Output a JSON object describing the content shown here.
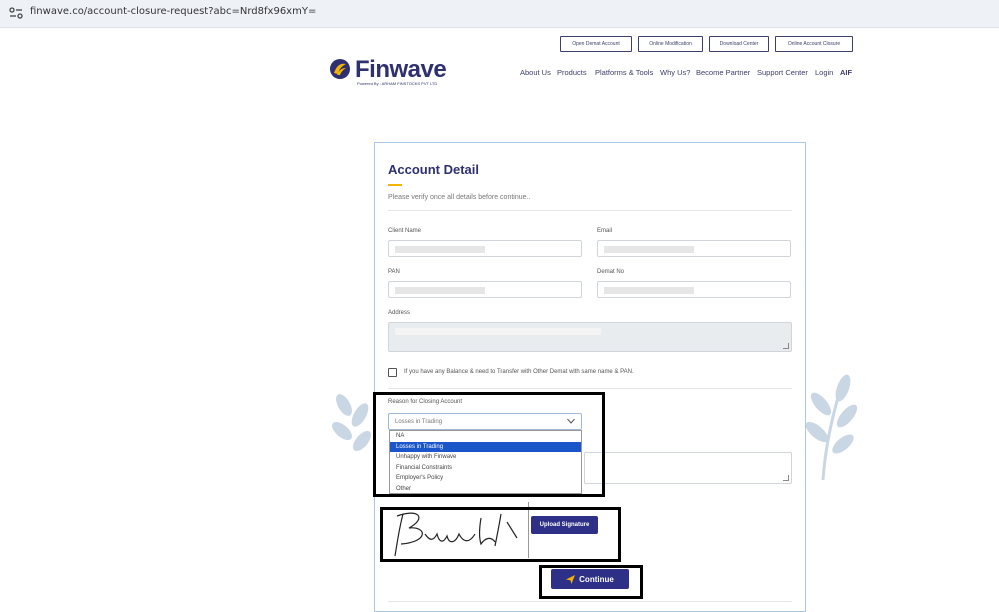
{
  "browser": {
    "url": "finwave.co/account-closure-request?abc=Nrd8fx96xmY="
  },
  "header": {
    "top_buttons": [
      "Open Demat Account",
      "Online Modification",
      "Download Center",
      "Online Account Closure"
    ],
    "logo_text": "Finwave",
    "logo_subtext": "Powered By : ARHAM FINSTOCKS PVT LTD",
    "nav": [
      "About Us",
      "Products",
      "Platforms & Tools",
      "Why Us?",
      "Become Partner",
      "Support Center",
      "Login",
      "AIF"
    ]
  },
  "form": {
    "title": "Account Detail",
    "subtitle": "Please verify once all details before continue..",
    "labels": {
      "client_name": "Client Name",
      "email": "Email",
      "pan": "PAN",
      "demat_no": "Demat No",
      "address": "Address"
    },
    "transfer_checkbox_label": "If you have any Balance & need to Transfer with Other Demat with same name & PAN.",
    "reason_label": "Reason for Closing Account",
    "reason_selected": "Losses in Trading",
    "reason_options": [
      "NA",
      "Losses in Trading",
      "Unhappy with Finwave",
      "Financial Constraints",
      "Employer's Policy",
      "Other"
    ],
    "upload_signature_label": "Upload Signature",
    "continue_label": "Continue"
  },
  "colors": {
    "brand": "#2e3070",
    "button": "#2e2f86",
    "accent": "#f5b400",
    "dropdown_highlight": "#1a56c9"
  }
}
